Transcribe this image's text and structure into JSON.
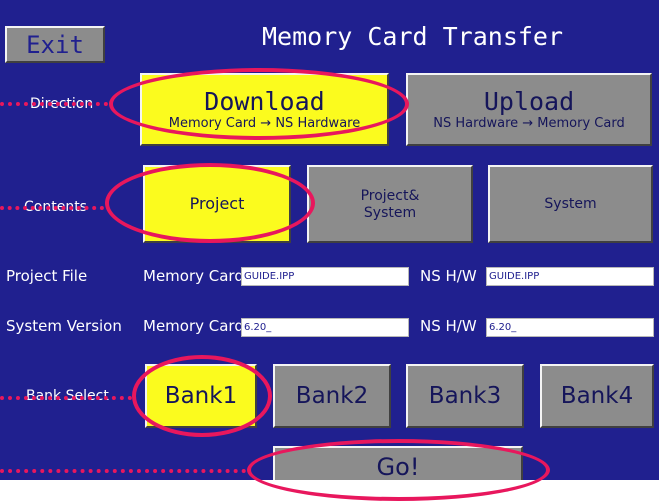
{
  "title": "Memory Card Transfer",
  "exit_label": "Exit",
  "direction": {
    "label": "Direction",
    "download": {
      "title": "Download",
      "sub": "Memory Card → NS Hardware"
    },
    "upload": {
      "title": "Upload",
      "sub": "NS Hardware → Memory Card"
    }
  },
  "contents": {
    "label": "Contents",
    "project": "Project",
    "project_system_1": "Project&",
    "project_system_2": "System",
    "system": "System"
  },
  "project_file": {
    "label": "Project File",
    "mc_label": "Memory Card",
    "mc_value": "GUIDE.IPP",
    "ns_label": "NS H/W",
    "ns_value": "GUIDE.IPP"
  },
  "system_version": {
    "label": "System Version",
    "mc_label": "Memory Card",
    "mc_value": "6.20_",
    "ns_label": "NS H/W",
    "ns_value": "6.20_"
  },
  "bank": {
    "label": "Bank Select",
    "b1": "Bank1",
    "b2": "Bank2",
    "b3": "Bank3",
    "b4": "Bank4"
  },
  "go_label": "Go!",
  "colors": {
    "background": "#20208f",
    "selected": "#fbfb1e",
    "unselected": "#8c8c8c",
    "highlight": "#e8175d"
  }
}
